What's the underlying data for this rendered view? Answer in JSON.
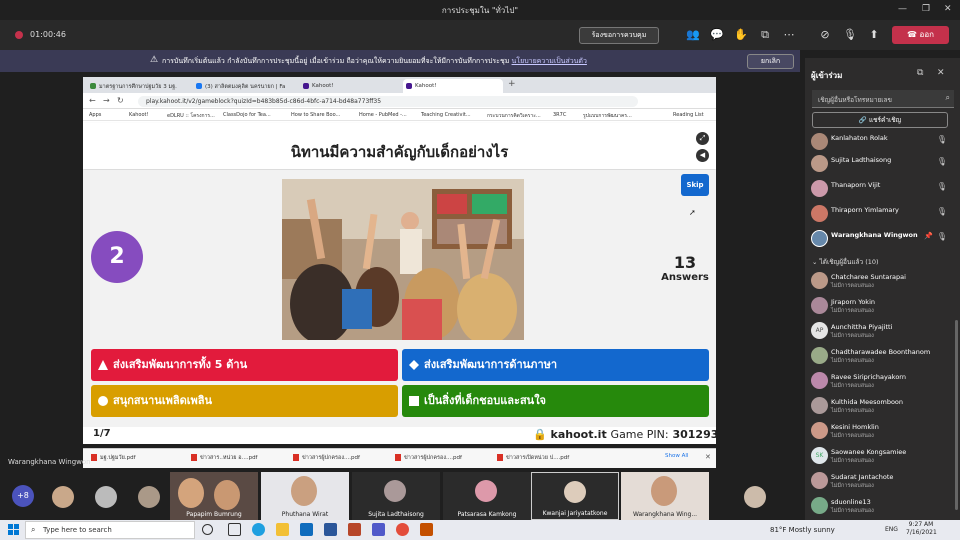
{
  "titlebar": {
    "title": "การประชุมใน \"ทั่วไป\"",
    "minimize": "—",
    "maximize": "❐",
    "close": "✕"
  },
  "meeting": {
    "timer": "01:00:46",
    "request_control": "ร้องขอการควบคุม",
    "leave": "ออก",
    "icons": [
      "people-icon",
      "chat-icon",
      "reactions-icon",
      "rooms-icon",
      "more-icon",
      "camera-off-icon",
      "mic-off-icon",
      "share-icon"
    ]
  },
  "banner": {
    "text": "การบันทึกเริ่มต้นแล้ว  กำลังบันทึกการประชุมนี้อยู่ เมื่อเข้าร่วม ถือว่าคุณให้ความยินยอมที่จะให้มีการบันทึกการประชุม",
    "link": "นโยบายความเป็นส่วนตัว",
    "dismiss": "ยกเลิก"
  },
  "browser": {
    "tabs": [
      {
        "label": "มาตรฐานการศึกษาปฐมวัย 3 มฐ.",
        "color": "#3c8a3c"
      },
      {
        "label": "(3) สาลิตตมงคุลิต นครนายก | Fa",
        "color": "#1877f2"
      },
      {
        "label": "Kahoot!",
        "color": "#46178f"
      },
      {
        "label": "Kahoot!",
        "color": "#46178f"
      }
    ],
    "url": "play.kahoot.it/v2/gameblock?quizId=b483b85d-c86d-4bfc-a714-bd48a773ff35",
    "bookmarks": [
      "Apps",
      "Kahoot!",
      "eDLRU :: โครงการ...",
      "ClassDojo for Tea...",
      "How to Share Boo...",
      "Home - PubMed -...",
      "Teaching Creativit...",
      "กระบวนการคิดวิเคราะ...",
      "3R7C",
      "รูปแบบการพัฒนาคร...",
      "Reading List"
    ]
  },
  "kahoot": {
    "question": "นิทานมีความสำคัญกับเด็กอย่างไร",
    "skip": "Skip",
    "timer": "2",
    "answers_count": "13",
    "answers_label": "Answers",
    "answers": [
      {
        "text": "ส่งเสริมพัฒนาการทั้ง 5 ด้าน",
        "shape": "triangle"
      },
      {
        "text": "ส่งเสริมพัฒนาการด้านภาษา",
        "shape": "diamond"
      },
      {
        "text": "สนุกสนานเพลิดเพลิน",
        "shape": "circle"
      },
      {
        "text": "เป็นสิ่งที่เด็กชอบและสนใจ",
        "shape": "square"
      }
    ],
    "progress": "1/7",
    "site": "kahoot.it",
    "pin_label": "Game PIN:",
    "pin": "301293"
  },
  "downloads": {
    "items": [
      "มฐ.ปฐมวัย.pdf",
      "ข่าวสาร..หน่วย อ....pdf",
      "ข่าวสารผู้ปกครอง....pdf",
      "ข่าวสารผู้ปกครอง....pdf",
      "ข่าวสารเปิดหน่วย ป....pdf"
    ],
    "show_all": "Show All"
  },
  "presenter": "Warangkhana Wingwon",
  "strip": {
    "more": "+8",
    "tiles": [
      {
        "name": "Papapim Bumrung"
      },
      {
        "name": "Phuthana Wirat"
      },
      {
        "name": "Sujita Ladthaisong"
      },
      {
        "name": "Patsarasa Kamkong"
      },
      {
        "name": "Kwanjai Jariyatatkone"
      },
      {
        "name": "Warangkhana Wing..."
      }
    ]
  },
  "panel": {
    "title": "ผู้เข้าร่วม",
    "invite_placeholder": "เชิญผู้อื่นหรือโทรหมายเลข",
    "share_invite": "แชร์คำเชิญ",
    "in_meeting": [
      {
        "name": "Kanlahaton Rolak",
        "status": ""
      },
      {
        "name": "Sujita Ladthaisong",
        "status": ""
      },
      {
        "name": "Thanaporn Vijit",
        "status": ""
      },
      {
        "name": "Thiraporn Yimlamary",
        "status": ""
      },
      {
        "name": "Warangkhana Wingwon",
        "status": ""
      }
    ],
    "invited_header": "ได้เชิญผู้อื่นแล้ว (10)",
    "invited": [
      {
        "name": "Chatcharee Suntarapai",
        "status": "ไม่มีการตอบสนอง",
        "initials": ""
      },
      {
        "name": "Jiraporn Yokin",
        "status": "ไม่มีการตอบสนอง",
        "initials": ""
      },
      {
        "name": "Aunchittha Piyajitti",
        "status": "ไม่มีการตอบสนอง",
        "initials": "AP"
      },
      {
        "name": "Chadtharawadee Boonthanom",
        "status": "ไม่มีการตอบสนอง",
        "initials": ""
      },
      {
        "name": "Ravee Siriprichayakorn",
        "status": "ไม่มีการตอบสนอง",
        "initials": ""
      },
      {
        "name": "Kulthida Meesomboon",
        "status": "ไม่มีการตอบสนอง",
        "initials": ""
      },
      {
        "name": "Kesini Homklin",
        "status": "ไม่มีการตอบสนอง",
        "initials": ""
      },
      {
        "name": "Saowanee Kongsamiee",
        "status": "ไม่มีการตอบสนอง",
        "initials": "SK"
      },
      {
        "name": "Sudarat Jantachote",
        "status": "ไม่มีการตอบสนอง",
        "initials": ""
      },
      {
        "name": "sduonline13",
        "status": "ไม่มีการตอบสนอง",
        "initials": ""
      }
    ]
  },
  "taskbar": {
    "search_placeholder": "Type here to search",
    "weather": "81°F  Mostly sunny",
    "lang": "ENG",
    "time": "9:27 AM",
    "date": "7/16/2021"
  },
  "colors": {
    "teams_accent": "#4b53bc",
    "leave_red": "#c4314b",
    "kahoot_purple": "#864cbf"
  }
}
